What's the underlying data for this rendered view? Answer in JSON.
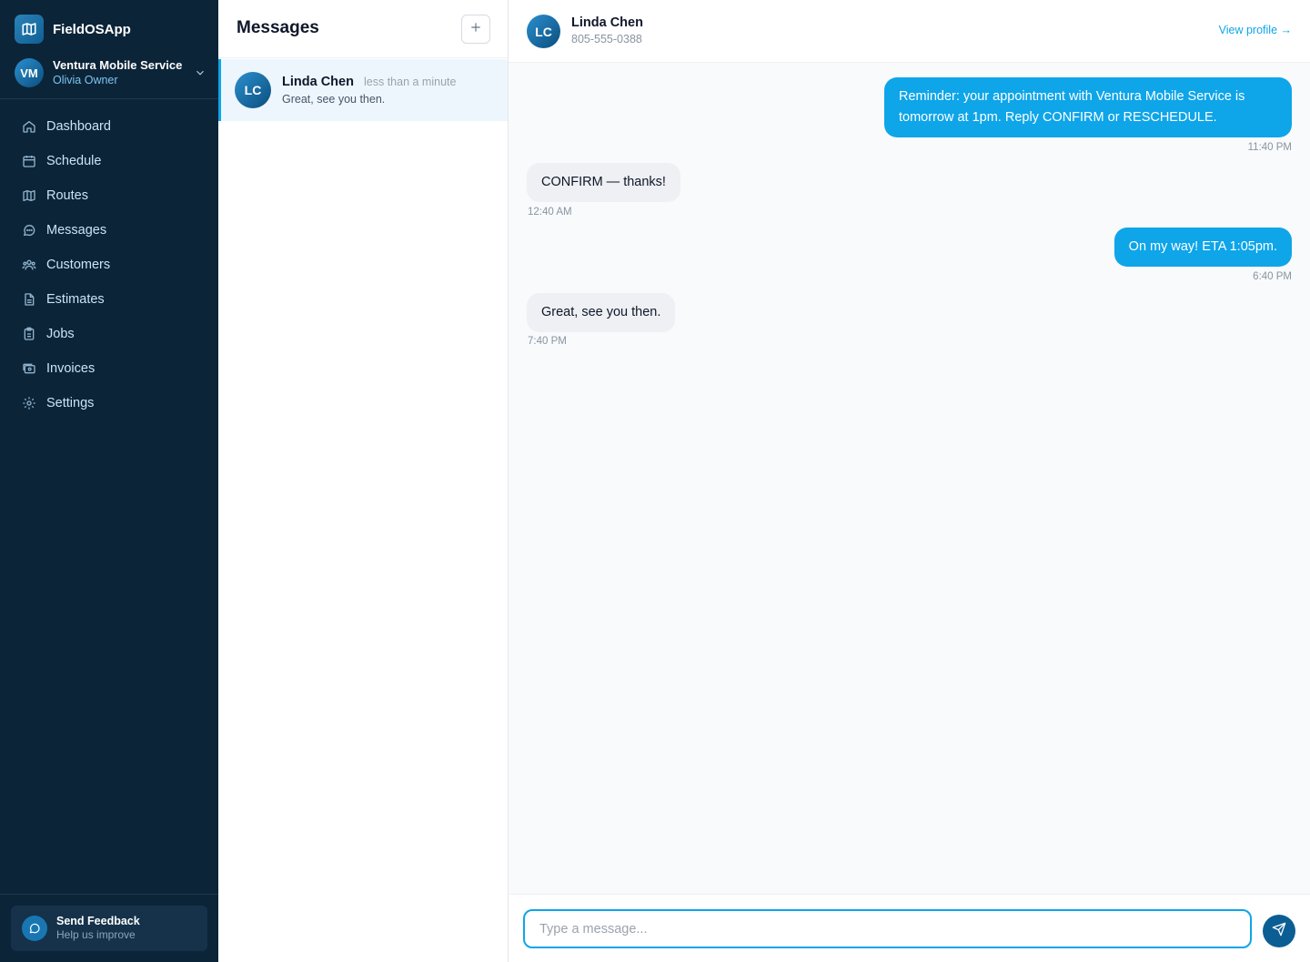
{
  "app": {
    "name": "FieldOSApp"
  },
  "org": {
    "initials": "VM",
    "name": "Ventura Mobile Service",
    "user": "Olivia Owner"
  },
  "nav": [
    {
      "label": "Dashboard",
      "icon": "home-icon"
    },
    {
      "label": "Schedule",
      "icon": "calendar-icon"
    },
    {
      "label": "Routes",
      "icon": "map-icon"
    },
    {
      "label": "Messages",
      "icon": "chat-icon"
    },
    {
      "label": "Customers",
      "icon": "users-icon"
    },
    {
      "label": "Estimates",
      "icon": "document-icon"
    },
    {
      "label": "Jobs",
      "icon": "clipboard-icon"
    },
    {
      "label": "Invoices",
      "icon": "invoice-icon"
    },
    {
      "label": "Settings",
      "icon": "gear-icon"
    }
  ],
  "feedback": {
    "title": "Send Feedback",
    "subtitle": "Help us improve"
  },
  "conversations": {
    "title": "Messages",
    "items": [
      {
        "initials": "LC",
        "name": "Linda Chen",
        "time": "less than a minute",
        "preview": "Great, see you then."
      }
    ]
  },
  "chat": {
    "contact": {
      "initials": "LC",
      "name": "Linda Chen",
      "phone": "805-555-0388"
    },
    "view_profile": "View profile →",
    "messages": [
      {
        "direction": "outgoing",
        "text": "Reminder: your appointment with Ventura Mobile Service is tomorrow at 1pm. Reply CONFIRM or RESCHEDULE.",
        "time": "11:40 PM"
      },
      {
        "direction": "incoming",
        "text": "CONFIRM — thanks!",
        "time": "12:40 AM"
      },
      {
        "direction": "outgoing",
        "text": "On my way! ETA 1:05pm.",
        "time": "6:40 PM"
      },
      {
        "direction": "incoming",
        "text": "Great, see you then.",
        "time": "7:40 PM"
      }
    ],
    "composer": {
      "placeholder": "Type a message...",
      "value": ""
    }
  },
  "colors": {
    "sidebar_bg": "#0c2438",
    "accent": "#0ea5e9",
    "send_button": "#0b5e94"
  }
}
